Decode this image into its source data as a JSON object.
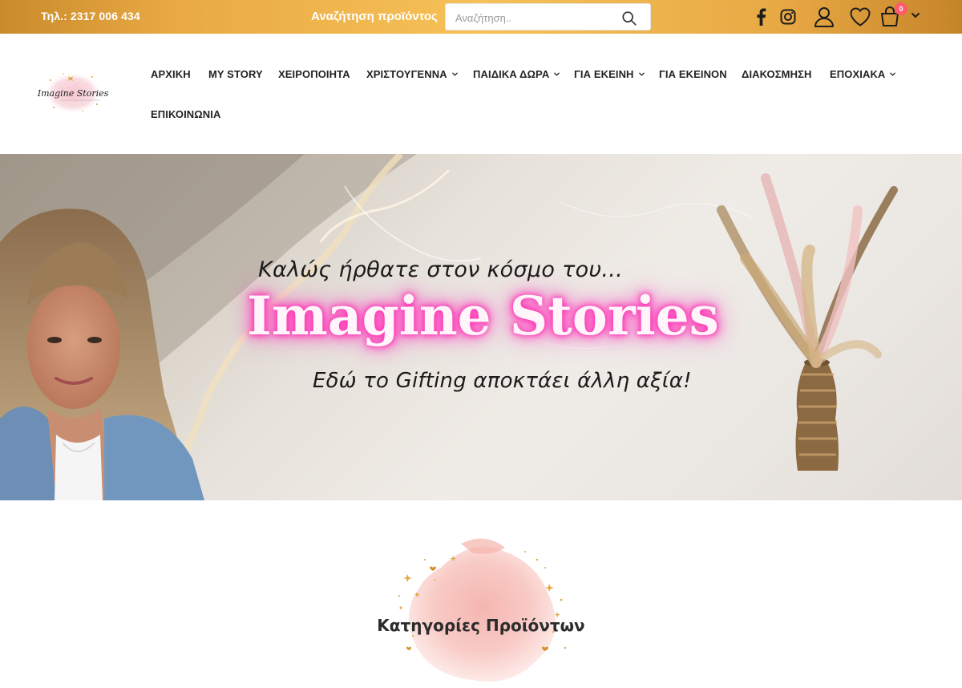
{
  "topbar": {
    "phone": "Τηλ.: 2317 006 434",
    "search_label": "Αναζήτηση προϊόντος",
    "search_placeholder": "Αναζήτηση..",
    "cart_count": "0"
  },
  "logo": {
    "text": "Imagine Stories"
  },
  "nav": {
    "items": [
      {
        "label": "ΑΡΧΙΚΗ",
        "has_dropdown": false
      },
      {
        "label": "MY STORY",
        "has_dropdown": false
      },
      {
        "label": "ΧΕΙΡΟΠΟΙΗΤΑ",
        "has_dropdown": false
      },
      {
        "label": "ΧΡΙΣΤΟΥΓΕΝΝΑ",
        "has_dropdown": true
      },
      {
        "label": "ΠΑΙΔΙΚΑ ΔΩΡΑ",
        "has_dropdown": true
      },
      {
        "label": "ΓΙΑ ΕΚΕΙΝΗ",
        "has_dropdown": true
      },
      {
        "label": "ΓΙΑ ΕΚΕΙΝΟΝ",
        "has_dropdown": false
      },
      {
        "label": "ΔΙΑΚΟΣΜΗΣΗ",
        "has_dropdown": false
      },
      {
        "label": "ΕΠΟΧΙΑΚΑ",
        "has_dropdown": true
      },
      {
        "label": "ΕΠΙΚΟΙΝΩΝΙΑ",
        "has_dropdown": false
      }
    ]
  },
  "hero": {
    "line1": "Καλώς ήρθατε στον κόσμο του...",
    "brand": "Imagine Stories",
    "line2": "Εδώ το Gifting αποκτάει άλλη αξία!"
  },
  "categories": {
    "title": "Κατηγορίες Προϊόντων"
  },
  "colors": {
    "topbar_accent": "#f0b34c",
    "brand_glow": "#ff2fb3",
    "cart_badge": "#ff5b6b"
  }
}
